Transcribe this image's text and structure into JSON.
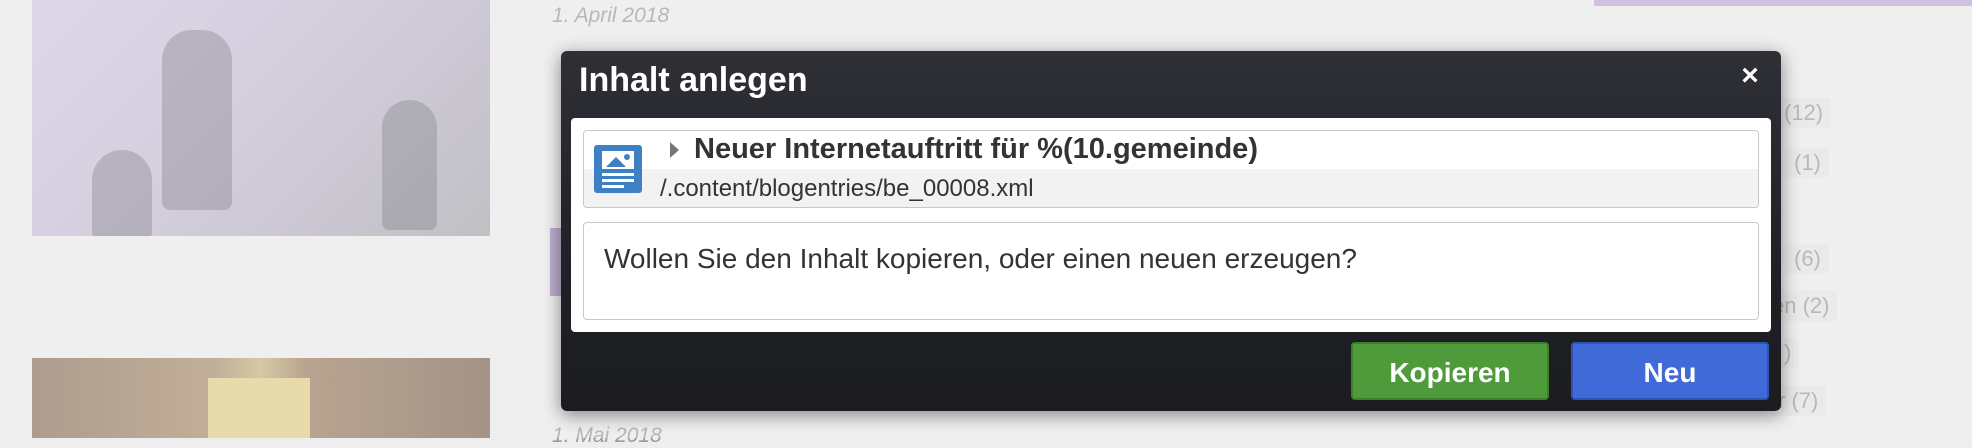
{
  "background": {
    "date_top": "1. April 2018",
    "date_bottom": "1. Mai 2018",
    "counts": [
      "(12)",
      "(1)",
      "(6)",
      "en (2)",
      ")",
      "r (7)"
    ]
  },
  "dialog": {
    "title": "Inhalt anlegen",
    "close_icon": "×",
    "resource": {
      "title": "Neuer Internetauftritt für %(10.gemeinde)",
      "path": "/.content/blogentries/be_00008.xml"
    },
    "message": "Wollen Sie den Inhalt kopieren, oder einen neuen erzeugen?",
    "buttons": {
      "copy": "Kopieren",
      "new": "Neu"
    }
  },
  "colors": {
    "dialog_bg": "#1f2126",
    "copy_button": "#4f9a3a",
    "new_button": "#3f6ad8",
    "resource_icon": "#3d80c4"
  }
}
